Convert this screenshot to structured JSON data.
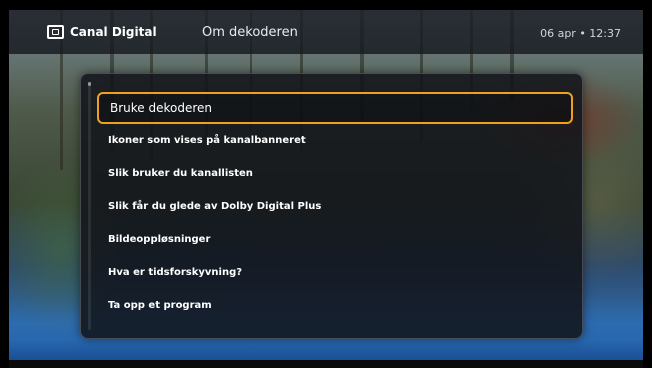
{
  "header": {
    "brand": "Canal Digital",
    "brand_icon": "tv-icon",
    "title": "Om dekoderen",
    "datetime": "06 apr • 12:37"
  },
  "menu": {
    "selected_index": 0,
    "accent_color": "#f0a11c",
    "items": [
      {
        "label": "Bruke dekoderen"
      },
      {
        "label": "Ikoner som vises på kanalbanneret"
      },
      {
        "label": "Slik bruker du kanallisten"
      },
      {
        "label": "Slik får du glede av Dolby Digital Plus"
      },
      {
        "label": "Bildeoppløsninger"
      },
      {
        "label": "Hva er tidsforskyvning?"
      },
      {
        "label": "Ta opp et program"
      }
    ]
  }
}
